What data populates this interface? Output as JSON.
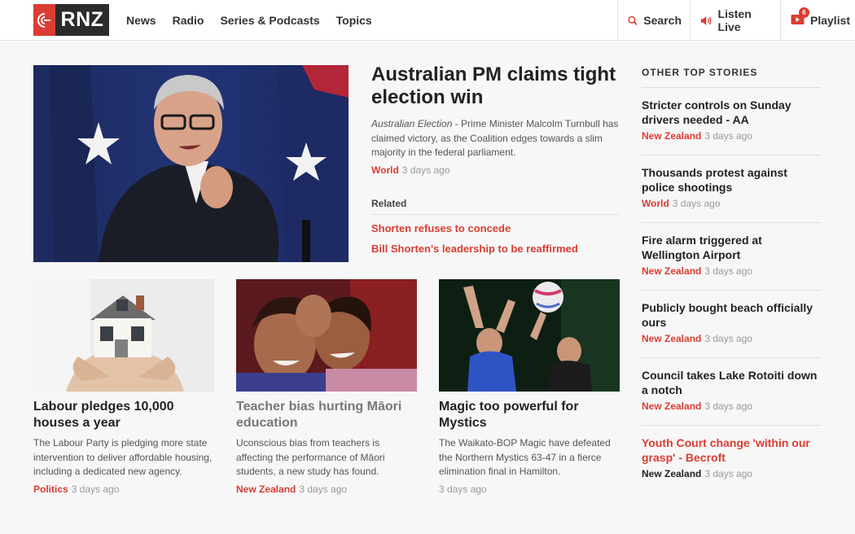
{
  "header": {
    "logo_text": "RNZ",
    "nav": [
      "News",
      "Radio",
      "Series & Podcasts",
      "Topics"
    ],
    "search_label": "Search",
    "listen_label": "Listen Live",
    "playlist_label": "Playlist",
    "playlist_count": "6"
  },
  "hero": {
    "title": "Australian PM claims tight election win",
    "summary_prefix": "Australian Election",
    "summary": " - Prime Minister Malcolm Turnbull has claimed victory, as the Coalition edges towards a slim majority in the federal parliament.",
    "category": "World",
    "time": "3 days ago",
    "related_label": "Related",
    "related": [
      "Shorten refuses to concede",
      "Bill Shorten's leadership to be reaffirmed"
    ]
  },
  "cards": [
    {
      "title": "Labour pledges 10,000 houses a year",
      "body": "The Labour Party is pledging more state intervention to deliver affordable housing, including a dedicated new agency.",
      "category": "Politics",
      "time": "3 days ago"
    },
    {
      "title": "Teacher bias hurting Māori education",
      "body": "Uconscious bias from teachers is affecting the performance of Māori students, a new study has found.",
      "category": "New Zealand",
      "time": "3 days ago"
    },
    {
      "title": "Magic too powerful for Mystics",
      "body": "The Waikato-BOP Magic have defeated the Northern Mystics 63-47 in a fierce elimination final in Hamilton.",
      "category": "",
      "time": "3 days ago"
    }
  ],
  "sidebar": {
    "heading": "OTHER TOP STORIES",
    "items": [
      {
        "title": "Stricter controls on Sunday drivers needed - AA",
        "category": "New Zealand",
        "time": "3 days ago"
      },
      {
        "title": "Thousands protest against police shootings",
        "category": "World",
        "time": "3 days ago"
      },
      {
        "title": "Fire alarm triggered at Wellington Airport",
        "category": "New Zealand",
        "time": "3 days ago"
      },
      {
        "title": "Publicly bought beach officially ours",
        "category": "New Zealand",
        "time": "3 days ago"
      },
      {
        "title": "Council takes Lake Rotoiti down a notch",
        "category": "New Zealand",
        "time": "3 days ago"
      },
      {
        "title": "Youth Court change 'within our grasp' - Becroft",
        "category": "New Zealand",
        "time": "3 days ago"
      }
    ]
  },
  "colors": {
    "accent": "#d93d33",
    "logo_bg": "#2b2b2b",
    "background": "#f7f7f7"
  }
}
